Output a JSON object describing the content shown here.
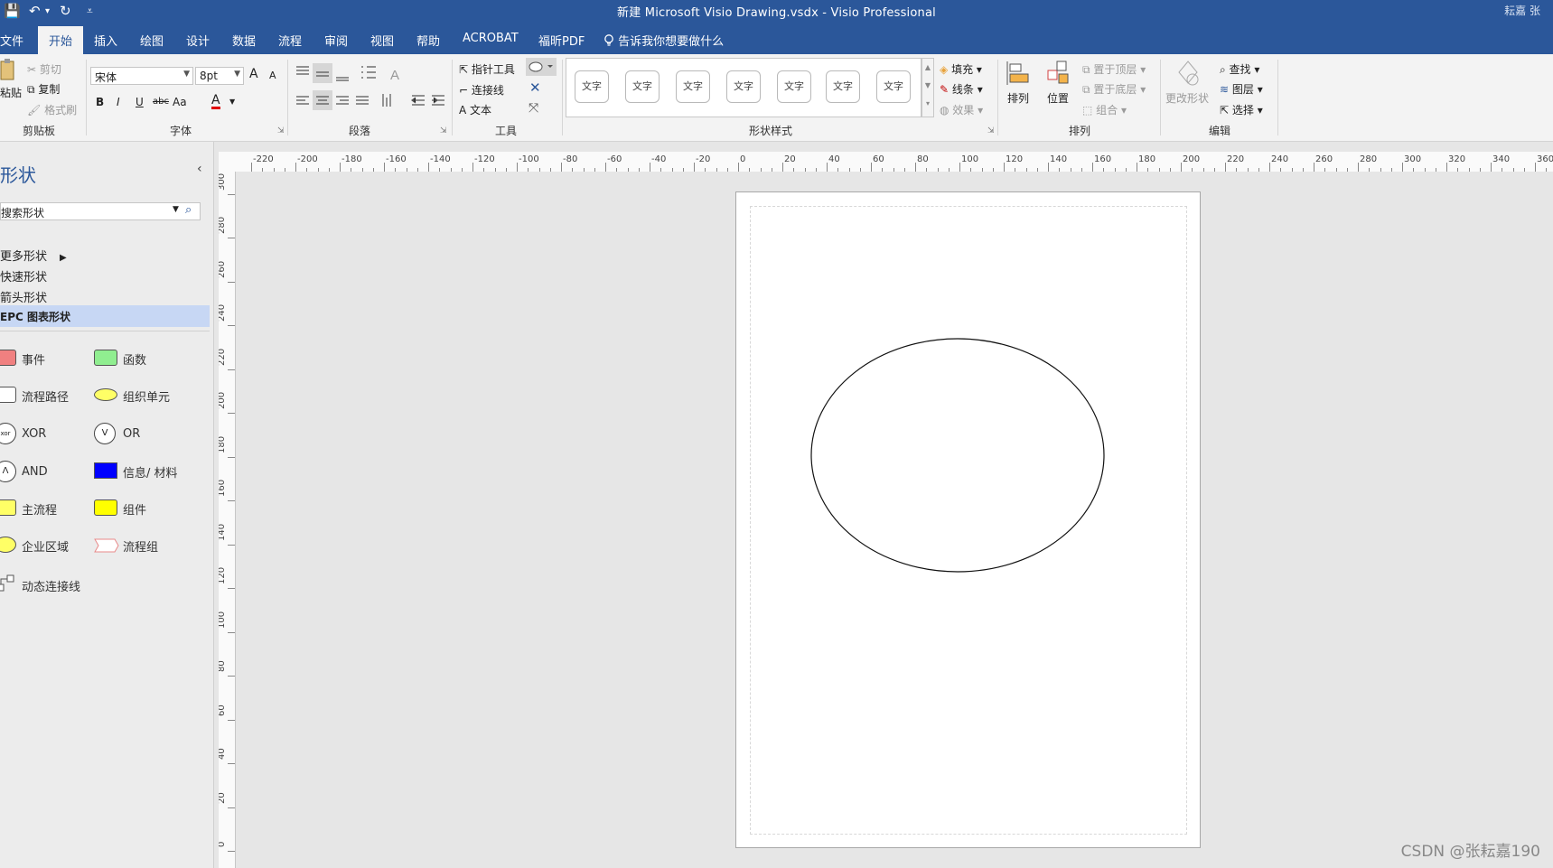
{
  "titlebar": {
    "title": "新建 Microsoft Visio Drawing.vsdx  -  Visio Professional",
    "user": "耘嘉 张",
    "qa_save": "💾",
    "qa_undo": "↶",
    "qa_undo_dd": "▾",
    "qa_redo": "↻",
    "qa_custom": "⩡"
  },
  "tabs": [
    "文件",
    "开始",
    "插入",
    "绘图",
    "设计",
    "数据",
    "流程",
    "审阅",
    "视图",
    "帮助",
    "ACROBAT",
    "福昕PDF"
  ],
  "active_tab": "开始",
  "tellme": "告诉我你想要做什么",
  "ribbon": {
    "clipboard": {
      "paste": "粘贴",
      "cut": "剪切",
      "copy": "复制",
      "format_painter": "格式刷",
      "label": "剪贴板"
    },
    "font": {
      "name": "宋体",
      "size": "8pt",
      "bold": "B",
      "italic": "I",
      "underline": "U",
      "strike": "abc",
      "case": "Aa",
      "color": "A",
      "grow": "A",
      "shrink": "A",
      "label": "字体"
    },
    "paragraph": {
      "label": "段落"
    },
    "tools": {
      "pointer": "指针工具",
      "connector": "连接线",
      "text": "文本",
      "label": "工具"
    },
    "shape_styles": {
      "sample": "文字",
      "label": "形状样式"
    },
    "fill": "填充",
    "line": "线条",
    "effects": "效果",
    "arrange": {
      "align": "排列",
      "position": "位置",
      "bring_front": "置于顶层",
      "send_back": "置于底层",
      "group": "组合",
      "label": "排列"
    },
    "editing": {
      "change_shape": "更改形状",
      "find": "查找",
      "layers": "图层",
      "select": "选择",
      "label": "编辑"
    }
  },
  "shapes_panel": {
    "title": "形状",
    "search_placeholder": "搜索形状",
    "more_shapes": "更多形状",
    "quick_shapes": "快速形状",
    "arrow_shapes": "箭头形状",
    "stencil": "EPC 图表形状",
    "items": [
      "事件",
      "函数",
      "流程路径",
      "组织单元",
      "XOR",
      "OR",
      "AND",
      "信息/ 材料",
      "主流程",
      "组件",
      "企业区域",
      "流程组",
      "动态连接线"
    ]
  },
  "ruler": {
    "h_labels": [
      "-220",
      "-200",
      "-180",
      "-160",
      "-140",
      "-120",
      "-100",
      "-80",
      "-60",
      "-40",
      "-20",
      "0",
      "20",
      "40",
      "60",
      "80",
      "100",
      "120",
      "140",
      "160",
      "180",
      "200",
      "220",
      "240",
      "260",
      "280",
      "300",
      "320",
      "340",
      "360"
    ],
    "v_labels": [
      "300",
      "280",
      "260",
      "240",
      "220",
      "200",
      "180",
      "160",
      "140",
      "120",
      "100",
      "80",
      "60",
      "40",
      "20",
      "0"
    ]
  },
  "watermark": "CSDN @张耘嘉190",
  "colors": {
    "accent": "#2b579a",
    "event": "#f08080",
    "function": "#90ee90",
    "info": "#0000ff",
    "yellow": "#ffff00"
  }
}
